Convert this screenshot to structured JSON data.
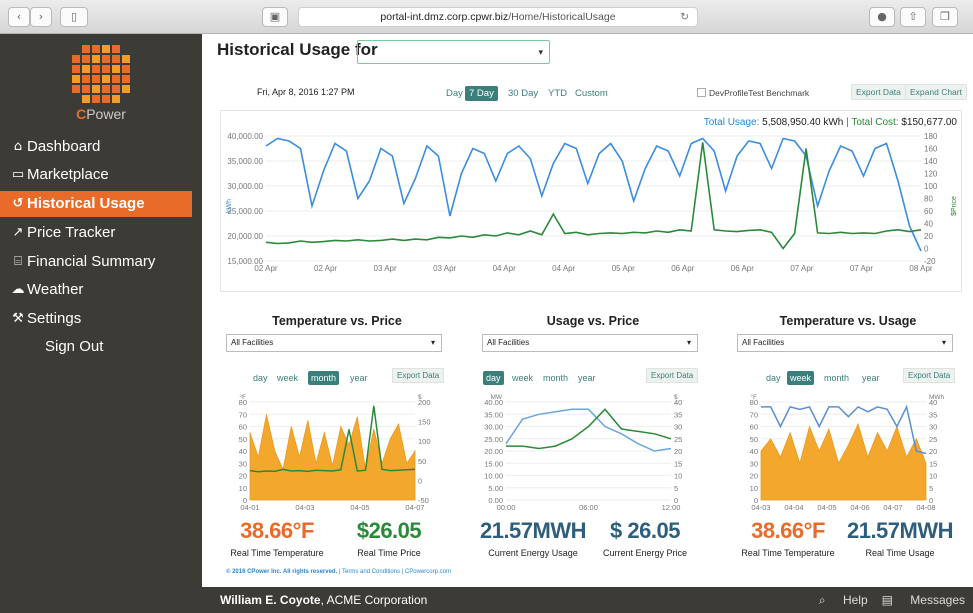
{
  "browser": {
    "url_prefix": "portal-int.dmz.corp.cpwr.biz",
    "url_path": "/Home/HistoricalUsage",
    "lock_icon": "lock-icon",
    "reload_icon": "reload-icon"
  },
  "brand": {
    "prefix": "C",
    "name": "Power"
  },
  "nav": [
    {
      "label": "Dashboard",
      "icon": "home-icon",
      "glyph": "⌂"
    },
    {
      "label": "Marketplace",
      "icon": "chart-box-icon",
      "glyph": "▭"
    },
    {
      "label": "Historical Usage",
      "icon": "history-icon",
      "glyph": "↺"
    },
    {
      "label": "Price Tracker",
      "icon": "line-chart-icon",
      "glyph": "↗"
    },
    {
      "label": "Financial Summary",
      "icon": "bank-icon",
      "glyph": "⌸"
    },
    {
      "label": "Weather",
      "icon": "cloud-icon",
      "glyph": "☁"
    },
    {
      "label": "Settings",
      "icon": "wrench-icon",
      "glyph": "⚒"
    },
    {
      "label": "Sign Out",
      "icon": "",
      "glyph": ""
    }
  ],
  "header": {
    "title": "Historical Usage for",
    "facility_placeholder": "· · ·"
  },
  "controls": {
    "date": "Fri, Apr 8, 2016 1:27 PM",
    "ranges": [
      "Day",
      "7 Day",
      "30 Day",
      "YTD",
      "Custom"
    ],
    "active_range": "7 Day",
    "benchmark_label": "DevProfileTest Benchmark",
    "export_label": "Export Data",
    "expand_label": "Expand Chart"
  },
  "totals": {
    "usage_label": "Total Usage:",
    "usage_value": "5,508,950.40 kWh",
    "sep": "|",
    "cost_label": "Total Cost:",
    "cost_value": "$150,677.00"
  },
  "chart_data": [
    {
      "type": "line",
      "title": "",
      "xlabel": "",
      "ylabel": "kWh",
      "y2label": "$Price",
      "x": [
        "02 Apr",
        "02 Apr",
        "03 Apr",
        "03 Apr",
        "04 Apr",
        "04 Apr",
        "05 Apr",
        "06 Apr",
        "06 Apr",
        "07 Apr",
        "07 Apr",
        "08 Apr"
      ],
      "ylim": [
        15000,
        40000
      ],
      "y2lim": [
        -20,
        180
      ],
      "yticks": [
        "40,000.00",
        "35,000.00",
        "30,000.00",
        "25,000.00",
        "20,000.00",
        "15,000.00"
      ],
      "y2ticks": [
        "180",
        "160",
        "140",
        "120",
        "100",
        "80",
        "60",
        "40",
        "20",
        "0",
        "-20"
      ],
      "series": [
        {
          "axis": "left",
          "color": "#3b8ddd",
          "values": [
            38000,
            39500,
            39000,
            37500,
            26000,
            33000,
            38500,
            37000,
            27500,
            31000,
            37500,
            36000,
            26500,
            31500,
            38000,
            36000,
            24000,
            32500,
            37500,
            36500,
            31000,
            36500,
            38000,
            35500,
            28000,
            34500,
            38500,
            37500,
            30500,
            36500,
            38500,
            35000,
            27000,
            33500,
            38000,
            37000,
            32000,
            38500,
            39500,
            37000,
            29000,
            36000,
            39000,
            38500,
            33500,
            39500,
            39000,
            36000,
            26000,
            33000,
            38000,
            37000,
            32000,
            37500,
            38500,
            31000,
            22000,
            17000
          ]
        },
        {
          "axis": "right",
          "color": "#2a8a3a",
          "values": [
            10,
            8,
            9,
            12,
            10,
            11,
            13,
            12,
            14,
            12,
            13,
            15,
            13,
            15,
            14,
            18,
            17,
            20,
            18,
            22,
            20,
            25,
            22,
            28,
            22,
            55,
            24,
            26,
            22,
            24,
            25,
            24,
            26,
            25,
            28,
            26,
            30,
            28,
            170,
            30,
            28,
            27,
            29,
            30,
            26,
            0,
            24,
            160,
            25,
            24,
            26,
            24,
            25,
            24,
            28,
            30,
            27,
            30
          ]
        }
      ]
    },
    {
      "type": "area",
      "title": "Temperature vs. Price",
      "x": [
        "04-01",
        "04-03",
        "04-05",
        "04-07"
      ],
      "ylabel": "°F",
      "y2label": "$",
      "ylim": [
        0,
        80
      ],
      "y2lim": [
        -50,
        200
      ],
      "yticks": [
        "80",
        "70",
        "60",
        "50",
        "40",
        "30",
        "20",
        "10",
        "0"
      ],
      "y2ticks": [
        "200",
        "150",
        "100",
        "50",
        "0",
        "-50"
      ],
      "series": [
        {
          "name": "",
          "color": "#f3a72d",
          "values": [
            55,
            35,
            70,
            40,
            25,
            60,
            35,
            65,
            30,
            55,
            28,
            60,
            45,
            68,
            25,
            58,
            30,
            50,
            62,
            30,
            40
          ]
        },
        {
          "name": "",
          "color": "#2a8a3a",
          "values": [
            25,
            22,
            24,
            23,
            28,
            24,
            25,
            23,
            26,
            25,
            24,
            27,
            130,
            24,
            26,
            190,
            28,
            25,
            26,
            27,
            28
          ]
        }
      ]
    },
    {
      "type": "line",
      "title": "Usage vs. Price",
      "x": [
        "00:00",
        "06:00",
        "12:00"
      ],
      "ylabel": "MW",
      "y2label": "$",
      "ylim": [
        0,
        40
      ],
      "y2lim": [
        0,
        40
      ],
      "yticks": [
        "40.00",
        "35.00",
        "30.00",
        "25.00",
        "20.00",
        "15.00",
        "10.00",
        "5.00",
        "0.00"
      ],
      "y2ticks": [
        "40",
        "35",
        "30",
        "25",
        "20",
        "15",
        "10",
        "5",
        "0"
      ],
      "series": [
        {
          "name": "",
          "color": "#6aa6dc",
          "values": [
            23,
            33,
            35,
            36,
            37,
            37,
            30,
            27,
            23,
            20,
            21
          ]
        },
        {
          "name": "",
          "color": "#2a8a3a",
          "values": [
            22,
            22,
            21,
            22,
            25,
            30,
            37,
            29,
            28,
            27,
            25
          ]
        }
      ]
    },
    {
      "type": "area",
      "title": "Temperature vs. Usage",
      "x": [
        "04-03",
        "04-04",
        "04-05",
        "04-06",
        "04-07",
        "04-08"
      ],
      "ylabel": "°F",
      "y2label": "MWh",
      "ylim": [
        0,
        80
      ],
      "y2lim": [
        0,
        40
      ],
      "yticks": [
        "80",
        "70",
        "60",
        "50",
        "40",
        "30",
        "20",
        "10",
        "0"
      ],
      "y2ticks": [
        "40",
        "35",
        "30",
        "25",
        "20",
        "15",
        "10",
        "5",
        "0"
      ],
      "series": [
        {
          "name": "",
          "color": "#f3a72d",
          "values": [
            40,
            50,
            35,
            55,
            30,
            60,
            40,
            58,
            30,
            45,
            62,
            35,
            55,
            40,
            60,
            35,
            50,
            30
          ]
        },
        {
          "name": "",
          "color": "#5a8fd0",
          "values": [
            38,
            38,
            30,
            38,
            37,
            38,
            30,
            38,
            38,
            34,
            38,
            36,
            38,
            37,
            30,
            38,
            20,
            19
          ]
        }
      ]
    }
  ],
  "panels": [
    {
      "title": "Temperature vs. Price",
      "select": "All Facilities",
      "periods": [
        "day",
        "week",
        "month",
        "year"
      ],
      "active": "month",
      "export": "Export Data",
      "v1": "38.66°F",
      "l1": "Real Time Temperature",
      "v2": "$26.05",
      "l2": "Real Time Price"
    },
    {
      "title": "Usage vs. Price",
      "select": "All Facilities",
      "periods": [
        "day",
        "week",
        "month",
        "year"
      ],
      "active": "day",
      "export": "Export Data",
      "v1": "21.57MWH",
      "l1": "Current Energy Usage",
      "v2": "$ 26.05",
      "l2": "Current Energy Price"
    },
    {
      "title": "Temperature vs. Usage",
      "select": "All Facilities",
      "periods": [
        "day",
        "week",
        "month",
        "year"
      ],
      "active": "week",
      "export": "Export Data",
      "v1": "38.66°F",
      "l1": "Real Time Temperature",
      "v2": "21.57MWH",
      "l2": "Real Time Usage"
    }
  ],
  "copyright": {
    "bold": "© 2016 CPower Inc. All rights reserved.",
    "rest": " | Terms and Conditions | CPowercorp.com"
  },
  "footer": {
    "user": "William E. Coyote",
    "org": ", ACME Corporation",
    "help": "Help",
    "messages": "Messages"
  }
}
